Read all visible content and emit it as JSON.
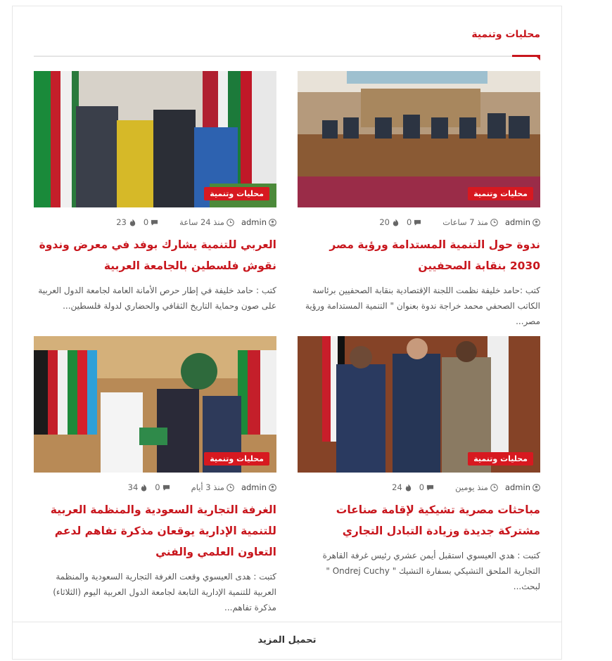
{
  "section": {
    "title": "محليات وتنمية"
  },
  "posts": [
    {
      "category": "محليات وتنمية",
      "author": "admin",
      "time": "منذ 7 ساعات",
      "comments": "0",
      "views": "20",
      "title": "ندوة حول التنمية المستدامة ورؤية مصر 2030 بنقابة الصحفيين",
      "excerpt": "كتب :حامد خليفة نظمت اللجنة الإقتصادية بنقابة الصحفيين برئاسة الكاتب الصحفي محمد خراجة ندوة بعنوان \" التنمية المستدامة ورؤية مصر..."
    },
    {
      "category": "محليات وتنمية",
      "author": "admin",
      "time": "منذ 24 ساعة",
      "comments": "0",
      "views": "23",
      "title": "العربي للتنمية يشارك بوفد في معرض وندوة نقوش فلسطين بالجامعة العربية",
      "excerpt": "كتب : حامد خليفة في إطار حرص الأمانة العامة لجامعة الدول العربية على صون وحماية التاريخ الثقافي والحضاري لدولة فلسطين..."
    },
    {
      "category": "محليات وتنمية",
      "author": "admin",
      "time": "منذ يومين",
      "comments": "0",
      "views": "24",
      "title": "مباحثات مصرية تشيكية لإقامة صناعات مشتركة جديدة وزيادة التبادل التجاري",
      "excerpt": "كتبت : هدي العيسوي استقبل أيمن عشري رئيس غرفة القاهرة التجارية الملحق التشيكي بسفارة التشيك \" Ondrej Cuchy \" لبحث..."
    },
    {
      "category": "محليات وتنمية",
      "author": "admin",
      "time": "منذ 3 أيام",
      "comments": "0",
      "views": "34",
      "title": "الغرفة التجارية السعودية والمنظمة العربية للتنمية الإدارية يوقعان مذكرة تفاهم لدعم التعاون العلمي والفني",
      "excerpt": "كتبت : هدى العيسوي وقعت الغرفة التجارية السعودية والمنظمة العربية للتنمية الإدارية التابعة لجامعة الدول العربية اليوم (الثلاثاء) مذكرة تفاهم..."
    }
  ],
  "load_more": "تحميل المزيد",
  "icons": [
    "user-icon",
    "clock-icon",
    "comment-icon",
    "flame-icon"
  ],
  "colors": {
    "accent": "#c8161d",
    "badge": "#d71920"
  }
}
